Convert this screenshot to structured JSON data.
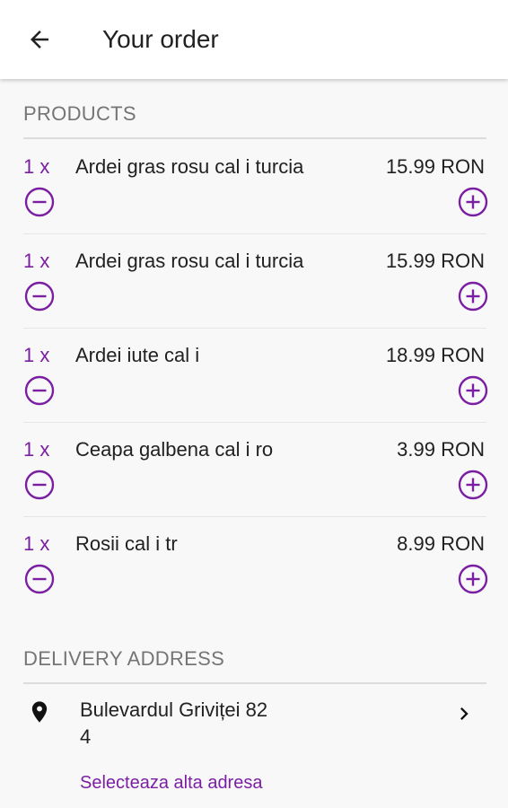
{
  "appbar": {
    "back_icon": "arrow-left-icon",
    "title": "Your order"
  },
  "products_section": {
    "title": "PRODUCTS",
    "items": [
      {
        "qty": "1 x",
        "name": "Ardei gras rosu cal i turcia",
        "price": "15.99 RON"
      },
      {
        "qty": "1 x",
        "name": "Ardei gras rosu cal i turcia",
        "price": "15.99 RON"
      },
      {
        "qty": "1 x",
        "name": "Ardei iute cal i",
        "price": "18.99 RON"
      },
      {
        "qty": "1 x",
        "name": "Ceapa galbena cal i ro",
        "price": "3.99 RON"
      },
      {
        "qty": "1 x",
        "name": "Rosii cal i tr",
        "price": "8.99 RON"
      }
    ],
    "minus_icon": "minus-circle-icon",
    "plus_icon": "plus-circle-icon"
  },
  "delivery_section": {
    "title": "DELIVERY ADDRESS",
    "address_line1": "Bulevardul Griviței 82",
    "address_line2": "4",
    "pin_icon": "location-pin-icon",
    "chevron_icon": "chevron-right-icon",
    "change_link": "Selecteaza alta adresa"
  },
  "colors": {
    "accent": "#7b1fa2",
    "background": "#f8f8f8",
    "appbar": "#ffffff",
    "section_title": "#757575"
  }
}
